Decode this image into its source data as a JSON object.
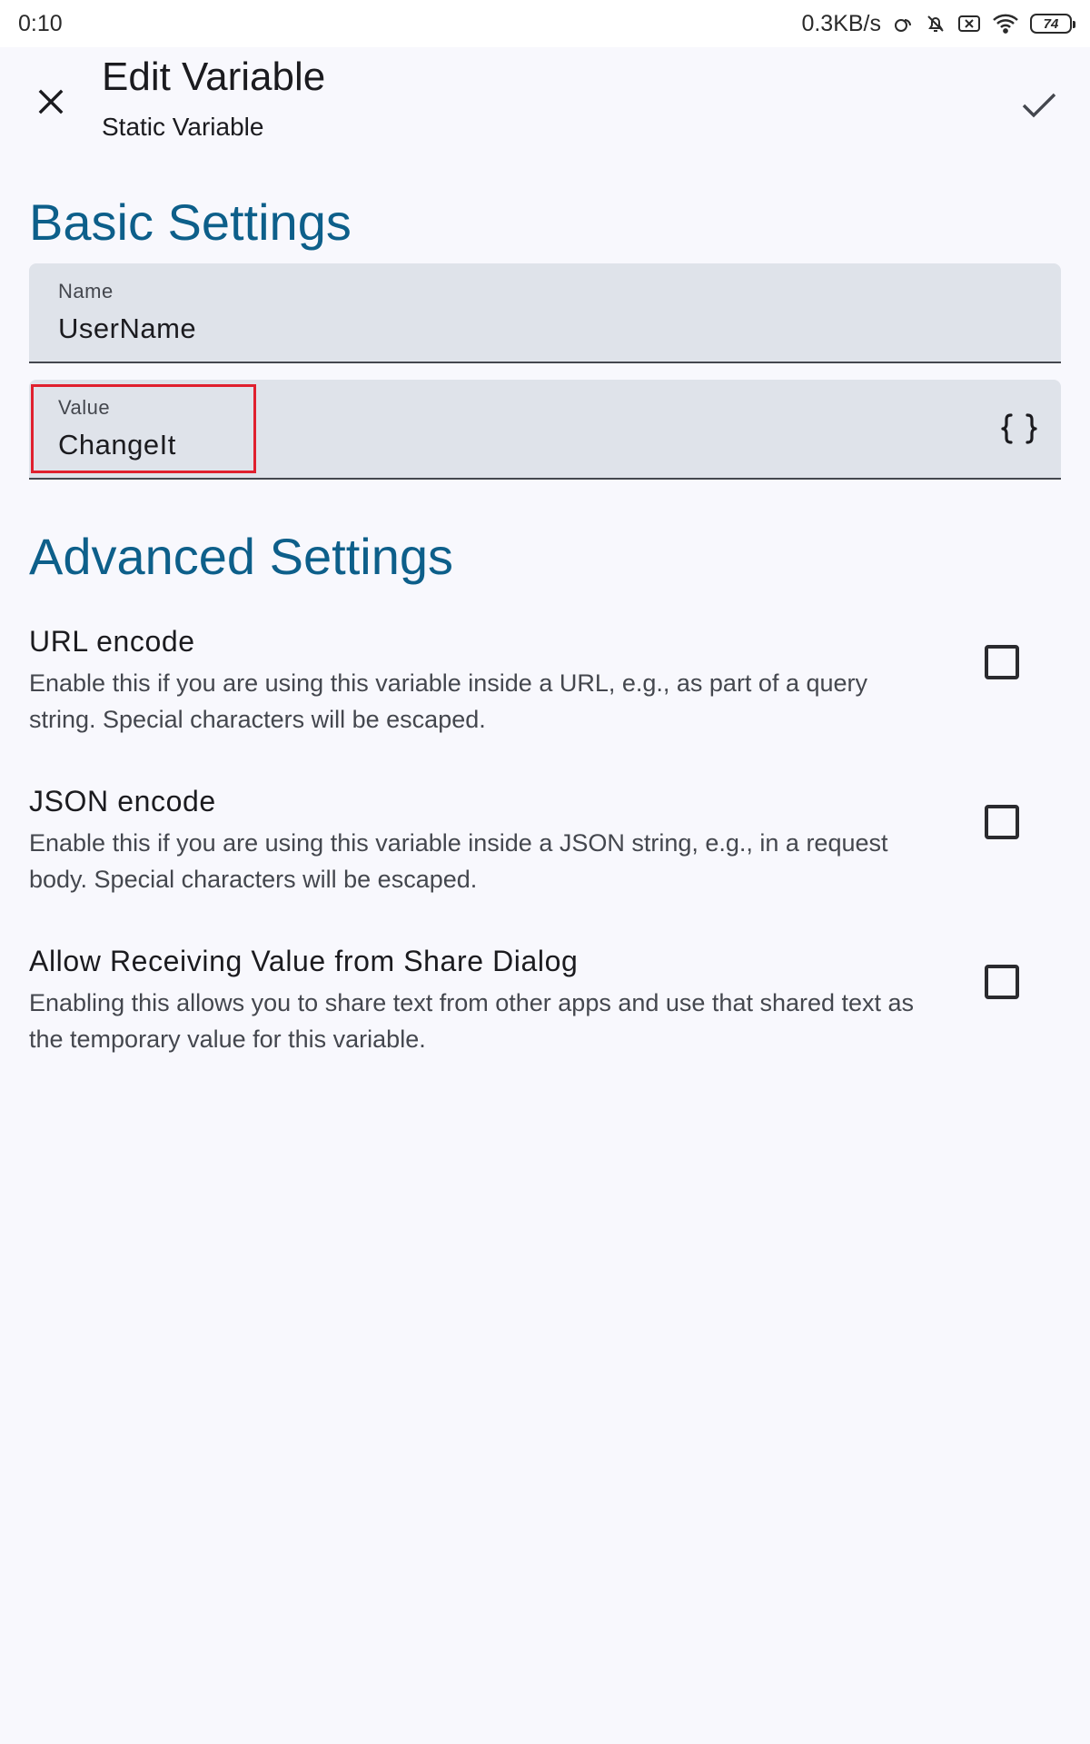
{
  "status_bar": {
    "time": "0:10",
    "network_speed": "0.3KB/s",
    "battery_level": "74",
    "icons": [
      "sync-icon",
      "bell-off-icon",
      "sim-card-icon",
      "wifi-icon",
      "battery-icon"
    ]
  },
  "app_bar": {
    "title": "Edit Variable",
    "subtitle": "Static Variable",
    "close_icon": "close-icon",
    "confirm_icon": "check-icon"
  },
  "basic_settings": {
    "heading": "Basic Settings",
    "name_field": {
      "label": "Name",
      "value": "UserName"
    },
    "value_field": {
      "label": "Value",
      "value": "ChangeIt",
      "action_icon": "curly-braces-icon"
    }
  },
  "advanced_settings": {
    "heading": "Advanced Settings",
    "items": [
      {
        "title": "URL encode",
        "description": "Enable this if you are using this variable inside a URL, e.g., as part of a query string. Special characters will be escaped.",
        "checked": false
      },
      {
        "title": "JSON encode",
        "description": "Enable this if you are using this variable inside a JSON string, e.g., in a request body. Special characters will be escaped.",
        "checked": false
      },
      {
        "title": "Allow Receiving Value from Share Dialog",
        "description": "Enabling this allows you to share text from other apps and use that shared text as the temporary value for this variable.",
        "checked": false
      }
    ]
  },
  "colors": {
    "accent": "#0d5f8a",
    "field_background": "#dfe3ea",
    "highlight": "#e0202e",
    "background": "#f8f8fd"
  }
}
